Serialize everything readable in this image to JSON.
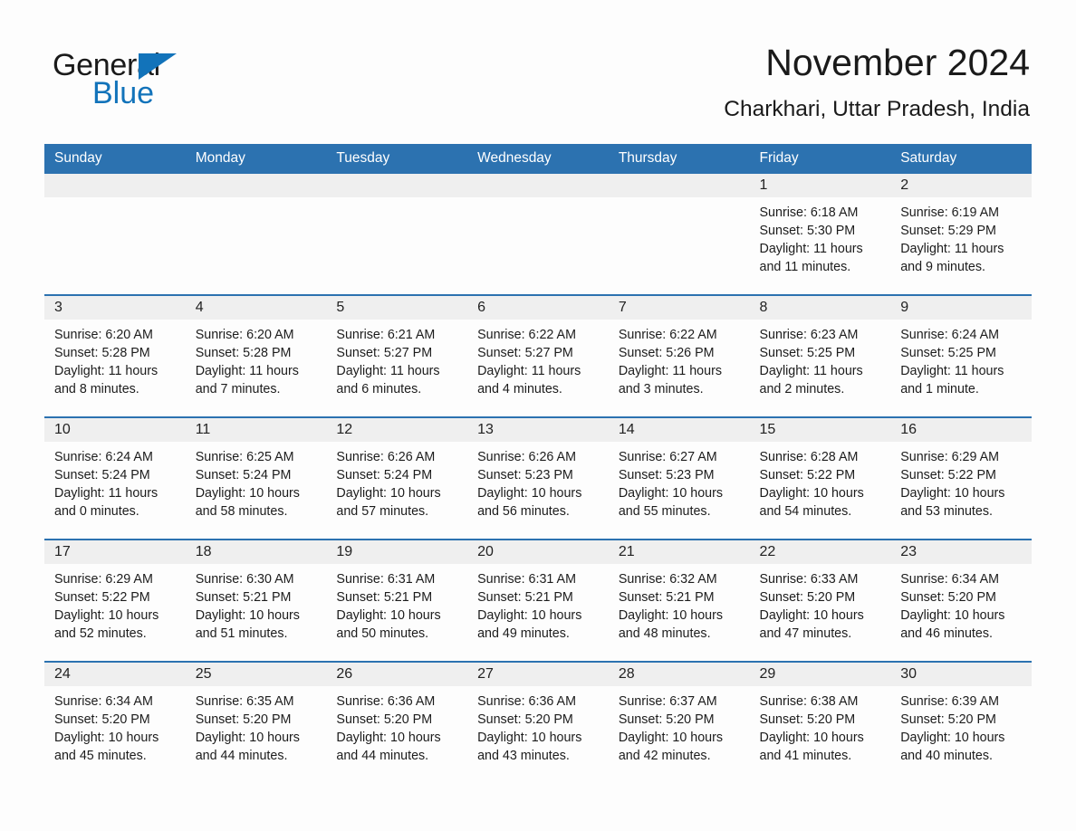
{
  "brand": {
    "name_part1": "General",
    "name_part2": "Blue",
    "triangle_color": "#1273ba",
    "accent_color": "#2c72b0"
  },
  "header": {
    "title": "November 2024",
    "location": "Charkhari, Uttar Pradesh, India"
  },
  "calendar": {
    "weekday_headers": [
      "Sunday",
      "Monday",
      "Tuesday",
      "Wednesday",
      "Thursday",
      "Friday",
      "Saturday"
    ],
    "labels": {
      "sunrise": "Sunrise:",
      "sunset": "Sunset:",
      "daylight": "Daylight:"
    },
    "weeks": [
      [
        {
          "day": "",
          "empty": true
        },
        {
          "day": "",
          "empty": true
        },
        {
          "day": "",
          "empty": true
        },
        {
          "day": "",
          "empty": true
        },
        {
          "day": "",
          "empty": true
        },
        {
          "day": "1",
          "sunrise": "Sunrise: 6:18 AM",
          "sunset": "Sunset: 5:30 PM",
          "daylight_line1": "Daylight: 11 hours",
          "daylight_line2": "and 11 minutes."
        },
        {
          "day": "2",
          "sunrise": "Sunrise: 6:19 AM",
          "sunset": "Sunset: 5:29 PM",
          "daylight_line1": "Daylight: 11 hours",
          "daylight_line2": "and 9 minutes."
        }
      ],
      [
        {
          "day": "3",
          "sunrise": "Sunrise: 6:20 AM",
          "sunset": "Sunset: 5:28 PM",
          "daylight_line1": "Daylight: 11 hours",
          "daylight_line2": "and 8 minutes."
        },
        {
          "day": "4",
          "sunrise": "Sunrise: 6:20 AM",
          "sunset": "Sunset: 5:28 PM",
          "daylight_line1": "Daylight: 11 hours",
          "daylight_line2": "and 7 minutes."
        },
        {
          "day": "5",
          "sunrise": "Sunrise: 6:21 AM",
          "sunset": "Sunset: 5:27 PM",
          "daylight_line1": "Daylight: 11 hours",
          "daylight_line2": "and 6 minutes."
        },
        {
          "day": "6",
          "sunrise": "Sunrise: 6:22 AM",
          "sunset": "Sunset: 5:27 PM",
          "daylight_line1": "Daylight: 11 hours",
          "daylight_line2": "and 4 minutes."
        },
        {
          "day": "7",
          "sunrise": "Sunrise: 6:22 AM",
          "sunset": "Sunset: 5:26 PM",
          "daylight_line1": "Daylight: 11 hours",
          "daylight_line2": "and 3 minutes."
        },
        {
          "day": "8",
          "sunrise": "Sunrise: 6:23 AM",
          "sunset": "Sunset: 5:25 PM",
          "daylight_line1": "Daylight: 11 hours",
          "daylight_line2": "and 2 minutes."
        },
        {
          "day": "9",
          "sunrise": "Sunrise: 6:24 AM",
          "sunset": "Sunset: 5:25 PM",
          "daylight_line1": "Daylight: 11 hours",
          "daylight_line2": "and 1 minute."
        }
      ],
      [
        {
          "day": "10",
          "sunrise": "Sunrise: 6:24 AM",
          "sunset": "Sunset: 5:24 PM",
          "daylight_line1": "Daylight: 11 hours",
          "daylight_line2": "and 0 minutes."
        },
        {
          "day": "11",
          "sunrise": "Sunrise: 6:25 AM",
          "sunset": "Sunset: 5:24 PM",
          "daylight_line1": "Daylight: 10 hours",
          "daylight_line2": "and 58 minutes."
        },
        {
          "day": "12",
          "sunrise": "Sunrise: 6:26 AM",
          "sunset": "Sunset: 5:24 PM",
          "daylight_line1": "Daylight: 10 hours",
          "daylight_line2": "and 57 minutes."
        },
        {
          "day": "13",
          "sunrise": "Sunrise: 6:26 AM",
          "sunset": "Sunset: 5:23 PM",
          "daylight_line1": "Daylight: 10 hours",
          "daylight_line2": "and 56 minutes."
        },
        {
          "day": "14",
          "sunrise": "Sunrise: 6:27 AM",
          "sunset": "Sunset: 5:23 PM",
          "daylight_line1": "Daylight: 10 hours",
          "daylight_line2": "and 55 minutes."
        },
        {
          "day": "15",
          "sunrise": "Sunrise: 6:28 AM",
          "sunset": "Sunset: 5:22 PM",
          "daylight_line1": "Daylight: 10 hours",
          "daylight_line2": "and 54 minutes."
        },
        {
          "day": "16",
          "sunrise": "Sunrise: 6:29 AM",
          "sunset": "Sunset: 5:22 PM",
          "daylight_line1": "Daylight: 10 hours",
          "daylight_line2": "and 53 minutes."
        }
      ],
      [
        {
          "day": "17",
          "sunrise": "Sunrise: 6:29 AM",
          "sunset": "Sunset: 5:22 PM",
          "daylight_line1": "Daylight: 10 hours",
          "daylight_line2": "and 52 minutes."
        },
        {
          "day": "18",
          "sunrise": "Sunrise: 6:30 AM",
          "sunset": "Sunset: 5:21 PM",
          "daylight_line1": "Daylight: 10 hours",
          "daylight_line2": "and 51 minutes."
        },
        {
          "day": "19",
          "sunrise": "Sunrise: 6:31 AM",
          "sunset": "Sunset: 5:21 PM",
          "daylight_line1": "Daylight: 10 hours",
          "daylight_line2": "and 50 minutes."
        },
        {
          "day": "20",
          "sunrise": "Sunrise: 6:31 AM",
          "sunset": "Sunset: 5:21 PM",
          "daylight_line1": "Daylight: 10 hours",
          "daylight_line2": "and 49 minutes."
        },
        {
          "day": "21",
          "sunrise": "Sunrise: 6:32 AM",
          "sunset": "Sunset: 5:21 PM",
          "daylight_line1": "Daylight: 10 hours",
          "daylight_line2": "and 48 minutes."
        },
        {
          "day": "22",
          "sunrise": "Sunrise: 6:33 AM",
          "sunset": "Sunset: 5:20 PM",
          "daylight_line1": "Daylight: 10 hours",
          "daylight_line2": "and 47 minutes."
        },
        {
          "day": "23",
          "sunrise": "Sunrise: 6:34 AM",
          "sunset": "Sunset: 5:20 PM",
          "daylight_line1": "Daylight: 10 hours",
          "daylight_line2": "and 46 minutes."
        }
      ],
      [
        {
          "day": "24",
          "sunrise": "Sunrise: 6:34 AM",
          "sunset": "Sunset: 5:20 PM",
          "daylight_line1": "Daylight: 10 hours",
          "daylight_line2": "and 45 minutes."
        },
        {
          "day": "25",
          "sunrise": "Sunrise: 6:35 AM",
          "sunset": "Sunset: 5:20 PM",
          "daylight_line1": "Daylight: 10 hours",
          "daylight_line2": "and 44 minutes."
        },
        {
          "day": "26",
          "sunrise": "Sunrise: 6:36 AM",
          "sunset": "Sunset: 5:20 PM",
          "daylight_line1": "Daylight: 10 hours",
          "daylight_line2": "and 44 minutes."
        },
        {
          "day": "27",
          "sunrise": "Sunrise: 6:36 AM",
          "sunset": "Sunset: 5:20 PM",
          "daylight_line1": "Daylight: 10 hours",
          "daylight_line2": "and 43 minutes."
        },
        {
          "day": "28",
          "sunrise": "Sunrise: 6:37 AM",
          "sunset": "Sunset: 5:20 PM",
          "daylight_line1": "Daylight: 10 hours",
          "daylight_line2": "and 42 minutes."
        },
        {
          "day": "29",
          "sunrise": "Sunrise: 6:38 AM",
          "sunset": "Sunset: 5:20 PM",
          "daylight_line1": "Daylight: 10 hours",
          "daylight_line2": "and 41 minutes."
        },
        {
          "day": "30",
          "sunrise": "Sunrise: 6:39 AM",
          "sunset": "Sunset: 5:20 PM",
          "daylight_line1": "Daylight: 10 hours",
          "daylight_line2": "and 40 minutes."
        }
      ]
    ]
  }
}
